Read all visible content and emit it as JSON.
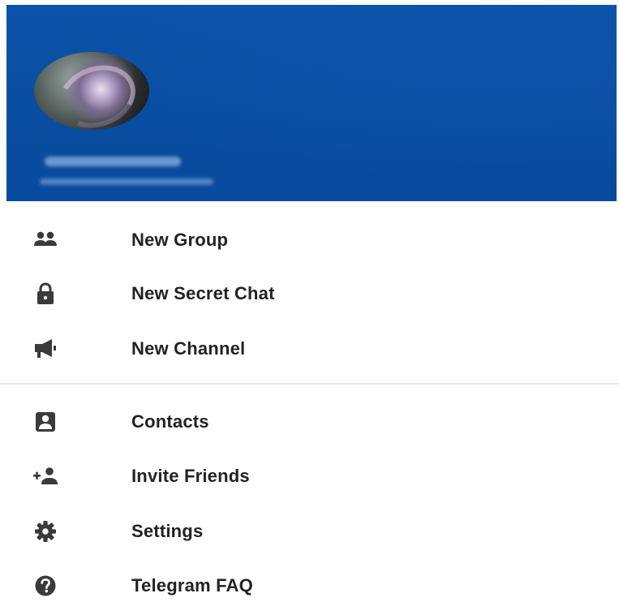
{
  "header": {
    "background_color": "#0a4fa3",
    "avatar_icon": "user-avatar-photo",
    "user_name": "",
    "user_phone": ""
  },
  "menu": {
    "group1": [
      {
        "label": "New Group",
        "icon": "group-icon"
      },
      {
        "label": "New Secret Chat",
        "icon": "lock-icon"
      },
      {
        "label": "New Channel",
        "icon": "megaphone-icon"
      }
    ],
    "group2": [
      {
        "label": "Contacts",
        "icon": "contact-card-icon"
      },
      {
        "label": "Invite Friends",
        "icon": "add-person-icon"
      },
      {
        "label": "Settings",
        "icon": "gear-icon"
      },
      {
        "label": "Telegram FAQ",
        "icon": "help-circle-icon"
      }
    ]
  },
  "colors": {
    "icon": "#3a3a3a",
    "text": "#222222",
    "divider": "#e6e6e6"
  }
}
